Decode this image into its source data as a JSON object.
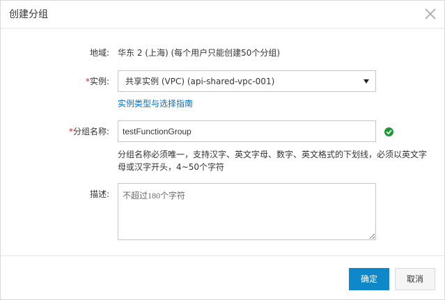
{
  "dialog": {
    "title": "创建分组",
    "close_icon": "close-icon"
  },
  "form": {
    "region": {
      "label": "地域:",
      "value": "华东 2 (上海) (每个用户只能创建50个分组)"
    },
    "instance": {
      "required_mark": "*",
      "label": "实例:",
      "selected": "共享实例 (VPC) (api-shared-vpc-001)",
      "link": "实例类型与选择指南"
    },
    "group_name": {
      "required_mark": "*",
      "label": "分组名称:",
      "value": "testFunctionGroup",
      "status_icon": "check-circle-icon",
      "help": "分组名称必须唯一，支持汉字、英文字母、数字、英文格式的下划线，必须以英文字母或汉字开头，4~50个字符"
    },
    "description": {
      "label": "描述:",
      "placeholder": "不超过180个字符",
      "value": ""
    }
  },
  "footer": {
    "confirm_label": "确定",
    "cancel_label": "取消"
  },
  "colors": {
    "primary": "#0e88c9",
    "link": "#0070cc",
    "required": "#e02020",
    "success": "#1e9a37"
  }
}
